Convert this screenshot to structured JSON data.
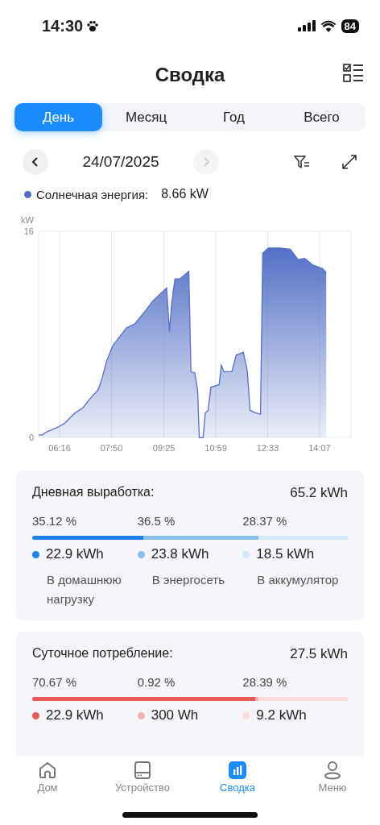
{
  "status_bar": {
    "time": "14:30",
    "battery": "84"
  },
  "header": {
    "title": "Сводка"
  },
  "tabs": [
    {
      "label": "День",
      "selected": true
    },
    {
      "label": "Месяц",
      "selected": false
    },
    {
      "label": "Год",
      "selected": false
    },
    {
      "label": "Всего",
      "selected": false
    }
  ],
  "date_nav": {
    "date": "24/07/2025",
    "prev_disabled": false,
    "next_disabled": true
  },
  "legend": {
    "label": "Солнечная энергия:",
    "value": "8.66 kW",
    "color": "#5470c6"
  },
  "chart_data": {
    "type": "area",
    "grid": true,
    "ylabel": "kW",
    "xlim": [
      338,
      904
    ],
    "ylim": [
      0,
      16
    ],
    "yticks": [
      0,
      16
    ],
    "xticks": [
      {
        "value": 376,
        "label": "06:16"
      },
      {
        "value": 470,
        "label": "07:50"
      },
      {
        "value": 565,
        "label": "09:25"
      },
      {
        "value": 659,
        "label": "10:59"
      },
      {
        "value": 753,
        "label": "12:33"
      },
      {
        "value": 847,
        "label": "14:07"
      }
    ],
    "x": [
      338,
      345,
      351,
      373,
      385,
      404,
      418,
      433,
      446,
      453,
      461,
      472,
      497,
      512,
      531,
      545,
      570,
      575,
      579,
      585,
      594,
      610,
      614,
      621,
      626,
      629,
      636,
      640,
      645,
      650,
      665,
      669,
      674,
      688,
      696,
      709,
      716,
      721,
      732,
      740,
      744,
      754,
      775,
      794,
      808,
      820,
      834,
      852,
      859
    ],
    "series": [
      {
        "color": "#5470c6",
        "values": [
          0.2,
          0.2,
          0.4,
          0.8,
          1.1,
          1.9,
          2.3,
          3.1,
          3.7,
          4.6,
          5.9,
          7.1,
          8.5,
          8.8,
          9.8,
          10.6,
          11.6,
          8.2,
          10.4,
          12.3,
          12.3,
          12.9,
          5.1,
          5.0,
          3.7,
          0,
          0,
          1.9,
          2.1,
          3.9,
          4.1,
          5.6,
          5.1,
          5.1,
          6.4,
          6.6,
          5.2,
          2.1,
          1.9,
          1.8,
          14.3,
          14.7,
          14.7,
          14.6,
          13.8,
          13.9,
          13.4,
          13.1,
          12.8
        ]
      }
    ]
  },
  "cards": [
    {
      "title": "Дневная выработка:",
      "total": "65.2 kWh",
      "segments": [
        {
          "percent": "35.12 %",
          "value": "22.9 kWh",
          "label": "В домашнюю нагрузку",
          "color": "#1a82e8"
        },
        {
          "percent": "36.5 %",
          "value": "23.8 kWh",
          "label": "В энергосеть",
          "color": "#86bff0"
        },
        {
          "percent": "28.37 %",
          "value": "18.5 kWh",
          "label": "В аккумулятор",
          "color": "#d3e8fa"
        }
      ]
    },
    {
      "title": "Суточное потребление:",
      "total": "27.5 kWh",
      "segments": [
        {
          "percent": "70.67 %",
          "value": "22.9 kWh",
          "color": "#ec5a55"
        },
        {
          "percent": "0.92 %",
          "value": "300 Wh",
          "color": "#f4b3b0"
        },
        {
          "percent": "28.39 %",
          "value": "9.2 kWh",
          "color": "#fbdcdb"
        }
      ]
    }
  ],
  "bottom_nav": [
    {
      "label": "Дом",
      "kind": "home",
      "selected": false
    },
    {
      "label": "Устройство",
      "kind": "device",
      "selected": false
    },
    {
      "label": "Сводка",
      "kind": "summary",
      "selected": true
    },
    {
      "label": "Меню",
      "kind": "profile",
      "selected": false
    }
  ]
}
